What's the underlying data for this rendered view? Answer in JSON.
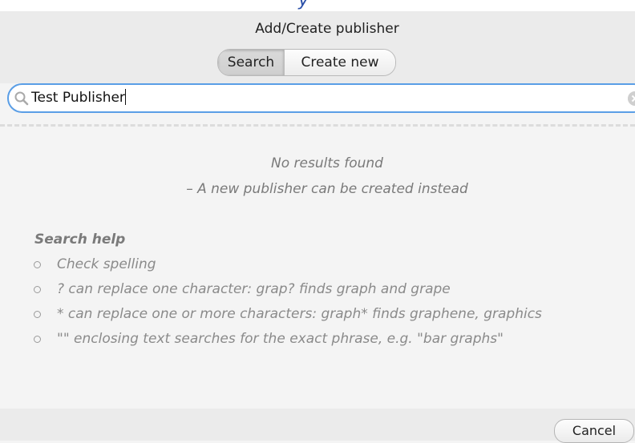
{
  "dialog": {
    "title": "Add/Create publisher",
    "tabs": [
      {
        "label": "Search",
        "active": true
      },
      {
        "label": "Create new",
        "active": false
      }
    ]
  },
  "search": {
    "value": "Test Publisher"
  },
  "results": {
    "line1": "No results found",
    "line2": "– A new publisher can be created instead"
  },
  "help": {
    "heading": "Search help",
    "items": [
      "Check spelling",
      "? can replace one character: grap? finds graph and grape",
      "* can replace one or more characters: graph* finds graphene, graphics",
      "\"\" enclosing text searches for the exact phrase, e.g. \"bar graphs\""
    ]
  },
  "footer": {
    "cancel_label": "Cancel"
  },
  "colors": {
    "focus_ring": "#5a9ee6",
    "dialog_bg": "#f4f4f4"
  }
}
